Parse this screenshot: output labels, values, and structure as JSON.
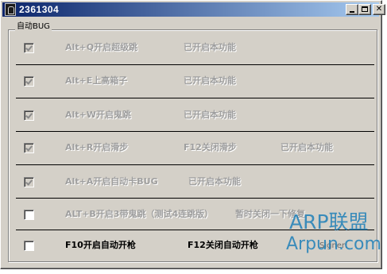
{
  "window": {
    "title": "2361304",
    "controls": [
      "minimize",
      "maximize",
      "close"
    ]
  },
  "group": {
    "legend": "自动BUG"
  },
  "rows": [
    {
      "checked": true,
      "enabled": false,
      "label": "Alt+Q开启超级跳",
      "col2": "已开启本功能",
      "col3": ""
    },
    {
      "checked": true,
      "enabled": false,
      "label": "Alt+E上高箱子",
      "col2": "已开启本功能",
      "col3": ""
    },
    {
      "checked": true,
      "enabled": false,
      "label": "Alt+W开启鬼跳",
      "col2": "已开启本功能",
      "col3": ""
    },
    {
      "checked": true,
      "enabled": false,
      "label": "Alt+R开启滑步",
      "col2": "F12关闭滑步",
      "col3": "已开启本功能"
    },
    {
      "checked": true,
      "enabled": false,
      "label": "Alt+A开启自动卡BUG",
      "col2": "已开启本功能",
      "col3": ""
    },
    {
      "checked": false,
      "enabled": true,
      "label": "ALT+B开启3带鬼跳（测试4连跳版）",
      "col2": "暂时关闭一下修复",
      "col3": ""
    },
    {
      "checked": false,
      "enabled": true,
      "label": "F10开启自动开枪",
      "col2": "F12关闭自动开枪",
      "col3": ""
    }
  ],
  "watermark": {
    "line1": "ARP联盟",
    "line2": "Arpun.com"
  },
  "signer": "Signer:",
  "colors": {
    "title_start": "#0a246a",
    "title_end": "#a6caf0",
    "face": "#d4d0c8",
    "disabled_text": "#9e9e9e",
    "watermark": "#1e7fb8"
  }
}
